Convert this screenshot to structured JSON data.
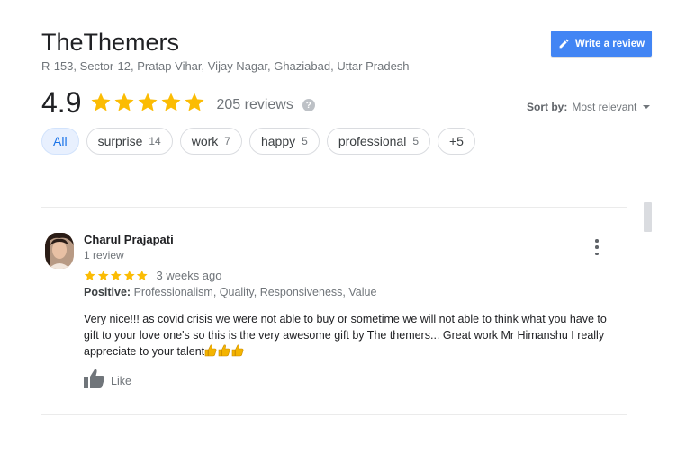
{
  "business": {
    "name": "TheThemers",
    "address": "R-153, Sector-12, Pratap Vihar, Vijay Nagar, Ghaziabad, Uttar Pradesh"
  },
  "write_review": {
    "label": "Write a review",
    "icon": "pencil-icon"
  },
  "rating": {
    "value": "4.9",
    "stars": 5,
    "review_count": "205 reviews",
    "help_icon": "?"
  },
  "sort": {
    "label": "Sort by:",
    "value": "Most relevant"
  },
  "chips": [
    {
      "label": "All",
      "count": ""
    },
    {
      "label": "surprise",
      "count": "14"
    },
    {
      "label": "work",
      "count": "7"
    },
    {
      "label": "happy",
      "count": "5"
    },
    {
      "label": "professional",
      "count": "5"
    },
    {
      "label": "+5",
      "count": ""
    }
  ],
  "review": {
    "reviewer_name": "Charul Prajapati",
    "reviewer_meta": "1 review",
    "stars": 5,
    "date": "3 weeks ago",
    "positive_label": "Positive:",
    "positive_values": "Professionalism, Quality, Responsiveness, Value",
    "text": "Very nice!!! as covid crisis we were not able to buy or sometime we will not able to think what you have to gift to your love one's so this is the very awesome gift by The themers... Great work Mr Himanshu I really appreciate to your talent",
    "like_label": "Like"
  },
  "colors": {
    "star": "#fbbc04",
    "button": "#4285f4",
    "chip_active_bg": "#e8f0fe",
    "chip_active_text": "#1a73e8"
  }
}
